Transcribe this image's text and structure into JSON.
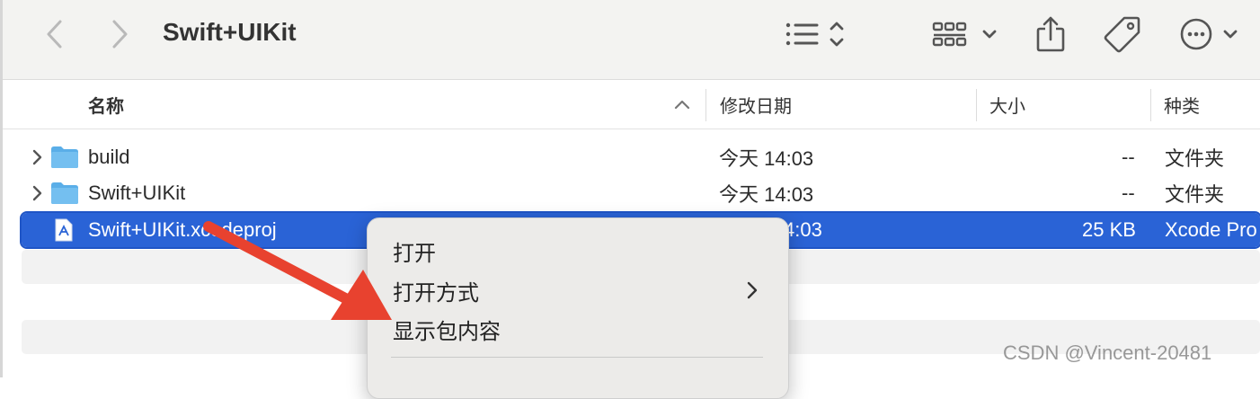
{
  "toolbar": {
    "title": "Swift+UIKit"
  },
  "columns": {
    "name": "名称",
    "modified": "修改日期",
    "size": "大小",
    "kind": "种类"
  },
  "rows": [
    {
      "name": "build",
      "modified": "今天 14:03",
      "size": "--",
      "kind": "文件夹"
    },
    {
      "name": "Swift+UIKit",
      "modified": "今天 14:03",
      "size": "--",
      "kind": "文件夹"
    },
    {
      "name": "Swift+UIKit.xcodeproj",
      "modified": "4:03",
      "size": "25 KB",
      "kind": "Xcode Pro"
    }
  ],
  "context_menu": {
    "items": [
      "打开",
      "打开方式",
      "显示包内容"
    ]
  },
  "watermark": "CSDN @Vincent-20481",
  "colors": {
    "selection": "#2a63d6",
    "folder": "#5aaee8",
    "arrow": "#e8422f"
  }
}
